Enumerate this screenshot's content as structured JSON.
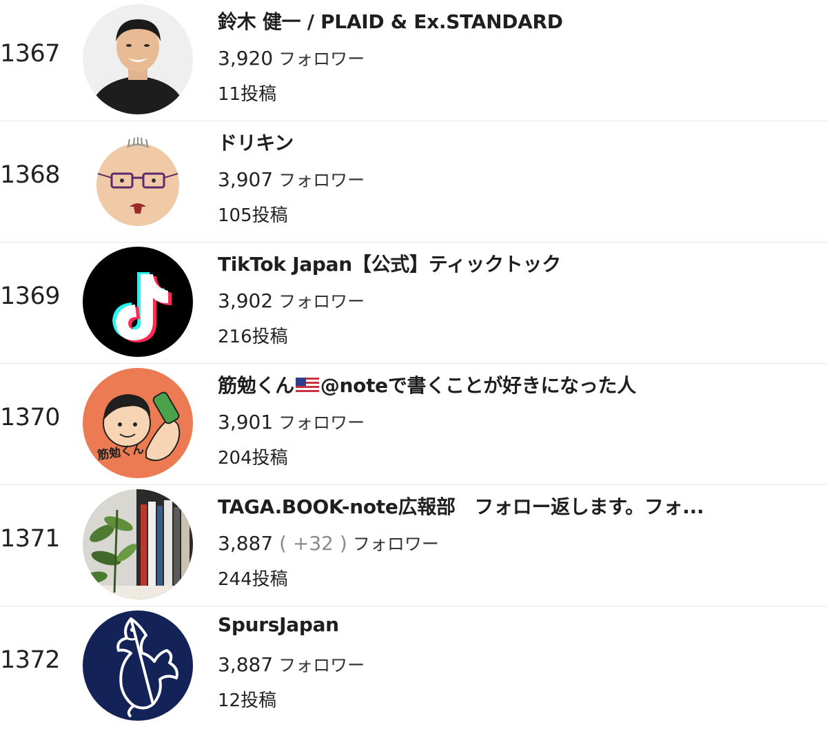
{
  "follower_unit": "フォロワー",
  "rows": [
    {
      "rank": "1367",
      "name": "鈴木 健一 / PLAID & Ex.STANDARD",
      "followers": "3,920",
      "posts": "11投稿",
      "avatar": "man-photo-avatar"
    },
    {
      "rank": "1368",
      "name": "ドリキン",
      "followers": "3,907",
      "posts": "105投稿",
      "avatar": "cartoon-face-glasses-avatar"
    },
    {
      "rank": "1369",
      "name": "TikTok Japan【公式】ティックトック",
      "followers": "3,902",
      "posts": "216投稿",
      "avatar": "tiktok-logo-avatar"
    },
    {
      "rank": "1370",
      "name_before_flag": "筋勉くん",
      "name_after_flag": "@noteで書くことが好きになった人",
      "flag": "us-flag-icon",
      "followers": "3,901",
      "posts": "204投稿",
      "avatar": "muscle-cartoon-avatar",
      "avatar_text": "筋勉くん"
    },
    {
      "rank": "1371",
      "name": "TAGA.BOOK-note広報部　フォロー返します。フォ...",
      "followers": "3,887",
      "delta": "( +32 )",
      "posts": "244投稿",
      "avatar": "bookshelf-plant-avatar"
    },
    {
      "rank": "1372",
      "name": "SpursJapan",
      "followers": "3,887",
      "posts": "12投稿",
      "avatar": "cockerel-logo-avatar"
    }
  ],
  "colors": {
    "text": "#222222",
    "delta": "#8a8a8a",
    "divider": "#e6e6e6",
    "tiktok_cyan": "#25f4ee",
    "tiktok_red": "#fe2c55",
    "spurs_navy": "#132257"
  }
}
